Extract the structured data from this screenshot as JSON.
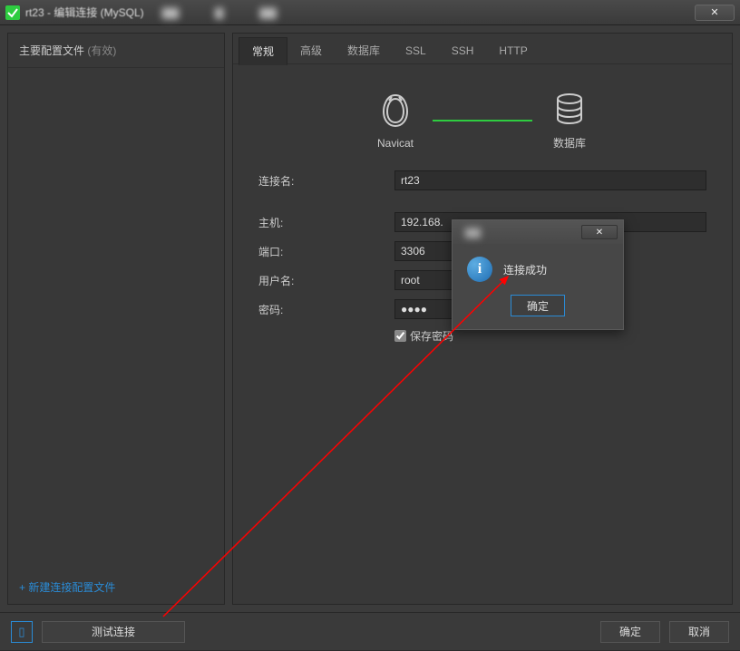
{
  "window": {
    "title": "rt23 - 编辑连接 (MySQL)"
  },
  "sidebar": {
    "title": "主要配置文件",
    "status_suffix": "(有效)",
    "new_profile": "+ 新建连接配置文件"
  },
  "tabs": [
    {
      "label": "常规",
      "active": true
    },
    {
      "label": "高级",
      "active": false
    },
    {
      "label": "数据库",
      "active": false
    },
    {
      "label": "SSL",
      "active": false
    },
    {
      "label": "SSH",
      "active": false
    },
    {
      "label": "HTTP",
      "active": false
    }
  ],
  "diagram": {
    "left_label": "Navicat",
    "right_label": "数据库"
  },
  "form": {
    "conn_name_label": "连接名:",
    "conn_name_value": "rt23",
    "host_label": "主机:",
    "host_value": "192.168.",
    "port_label": "端口:",
    "port_value": "3306",
    "user_label": "用户名:",
    "user_value": "root",
    "pass_label": "密码:",
    "pass_value": "●●●●",
    "save_pass_label": "保存密码"
  },
  "dialog": {
    "message": "连接成功",
    "ok_label": "确定"
  },
  "footer": {
    "test_label": "测试连接",
    "ok_label": "确定",
    "cancel_label": "取消"
  }
}
